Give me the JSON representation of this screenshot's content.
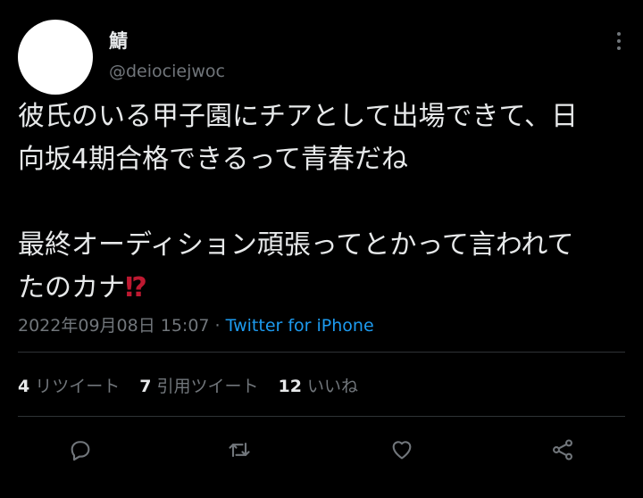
{
  "tweet": {
    "display_name": "鯖",
    "handle": "@deiociejwoc",
    "text_line1": "彼氏のいる甲子園にチアとして出場できて、日\n向坂4期合格できるって青春だね\n\n最終オーディション頑張ってとかって言われて\nたのカナ",
    "emoji": "⁉",
    "timestamp": "2022年09月08日 15:07",
    "separator": " · ",
    "source": "Twitter for iPhone"
  },
  "stats": {
    "retweets_count": "4",
    "retweets_label": "リツイート",
    "quotes_count": "7",
    "quotes_label": "引用ツイート",
    "likes_count": "12",
    "likes_label": "いいね"
  },
  "colors": {
    "background": "#000000",
    "text": "#e7e9ea",
    "muted": "#71767b",
    "link": "#1d9bf0",
    "divider": "#2f3336",
    "emoji": "#be1931"
  },
  "icons": {
    "reply": "reply-icon",
    "retweet": "retweet-icon",
    "like": "heart-icon",
    "share": "share-icon",
    "more": "more-icon"
  }
}
